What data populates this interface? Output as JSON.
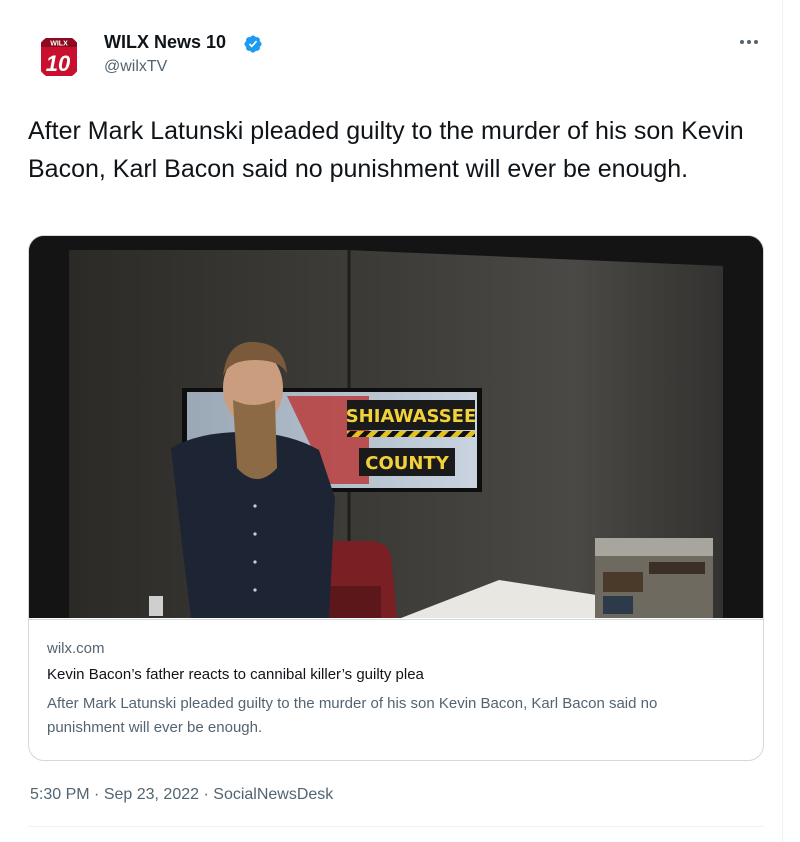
{
  "account": {
    "display_name": "WILX News 10",
    "handle": "@wilxTV",
    "logo_text_top": "WILX",
    "logo_text_main": "10",
    "verified": true
  },
  "tweet": {
    "text": "After Mark Latunski pleaded guilty to the murder of his son Kevin Bacon, Karl Bacon said no punishment will ever be enough.",
    "time": "5:30 PM",
    "separator": "·",
    "date": "Sep 23, 2022",
    "source": "SocialNewsDesk"
  },
  "card": {
    "domain": "wilx.com",
    "title": "Kevin Bacon’s father reacts to cannibal killer’s guilty plea",
    "description": "After Mark Latunski pleaded guilty to the murder of his son Kevin Bacon, Karl Bacon said no punishment will ever be enough.",
    "image_sign_line1": "SHIAWASSEE",
    "image_sign_line2": "COUNTY"
  },
  "icons": {
    "verified": "verified-badge-icon",
    "more": "more-options-icon"
  },
  "colors": {
    "verified_blue": "#1d9bf0",
    "secondary_text": "#536471",
    "logo_red": "#c8102e"
  }
}
